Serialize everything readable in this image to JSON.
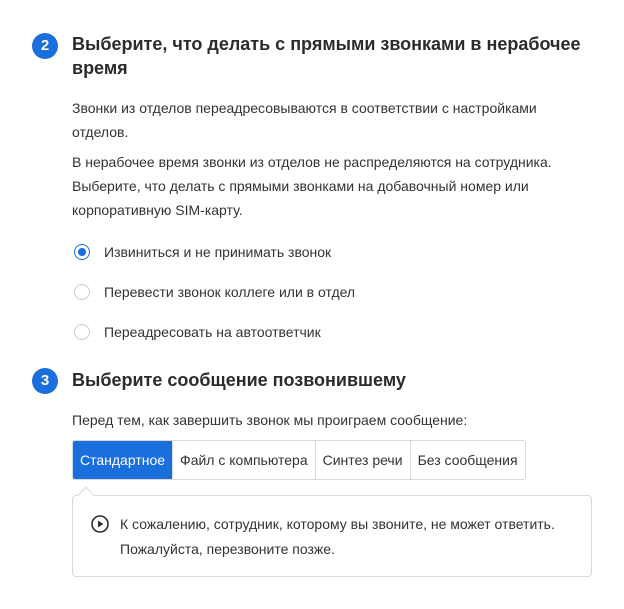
{
  "step2": {
    "number": "2",
    "title": "Выберите, что делать с прямыми звонками в нерабочее время",
    "para1": "Звонки из отделов переадресовываются в соответствии с настройками отделов.",
    "para2": "В нерабочее время звонки из отделов не распределяются на сотрудника. Выберите, что делать с прямыми звонками на добавочный номер или корпоративную SIM-карту.",
    "options": [
      {
        "label": "Извиниться и не принимать звонок",
        "selected": true
      },
      {
        "label": "Перевести звонок коллеге или в отдел",
        "selected": false
      },
      {
        "label": "Переадресовать на автоответчик",
        "selected": false
      }
    ]
  },
  "step3": {
    "number": "3",
    "title": "Выберите сообщение позвонившему",
    "intro": "Перед тем, как завершить звонок мы проиграем сообщение:",
    "tabs": [
      {
        "label": "Стандартное",
        "active": true
      },
      {
        "label": "Файл с компьютера",
        "active": false
      },
      {
        "label": "Синтез речи",
        "active": false
      },
      {
        "label": "Без сообщения",
        "active": false
      }
    ],
    "message": "К сожалению, сотрудник, которому вы звоните, не может ответить. Пожалуйста, перезвоните позже.",
    "play_icon": "play-circle-icon"
  },
  "colors": {
    "accent": "#1a6fdc",
    "border": "#d6d9de",
    "text": "#333333"
  }
}
